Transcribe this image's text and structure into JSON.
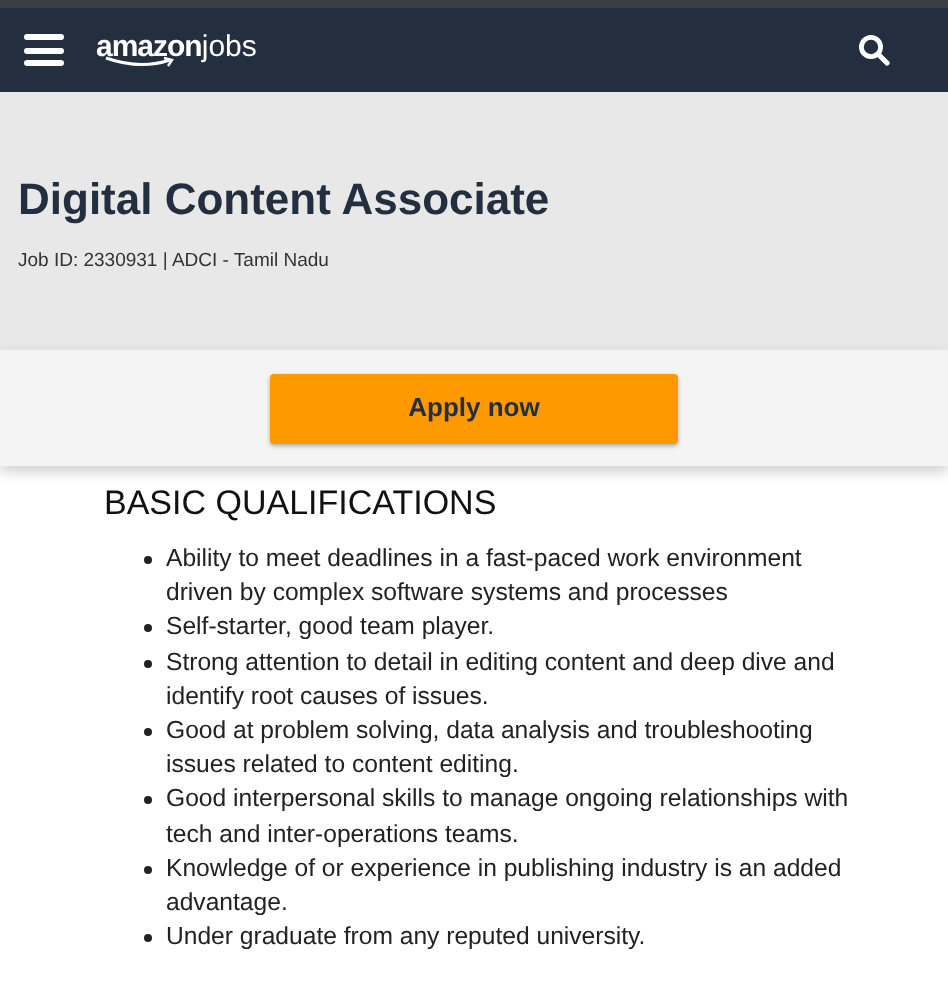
{
  "header": {
    "logo": {
      "brand": "amazon",
      "suffix": "jobs"
    }
  },
  "job": {
    "title": "Digital Content Associate",
    "meta": "Job ID: 2330931 | ADCI - Tamil Nadu"
  },
  "apply_button": "Apply now",
  "section": {
    "heading": "BASIC QUALIFICATIONS",
    "items": [
      "Ability to meet deadlines in a fast-paced work environment driven by complex software systems and processes",
      "Self-starter, good team player.",
      "Strong attention to detail in editing content and deep dive and identify root causes of issues.",
      "Good at problem solving, data analysis and troubleshooting issues related to content editing.",
      "Good interpersonal skills to manage ongoing relationships with tech and inter-operations teams.",
      "Knowledge of or experience in publishing industry is an added advantage.",
      "Under graduate from any reputed university."
    ]
  }
}
